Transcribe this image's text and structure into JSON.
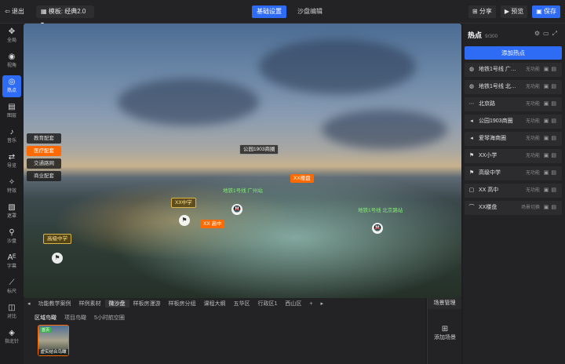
{
  "topbar": {
    "exit_label": "退出",
    "template_label": "模板: 经典2.0",
    "tabs": [
      {
        "label": "基础设置",
        "active": true
      },
      {
        "label": "沙盘编辑",
        "active": false
      }
    ],
    "share_label": "分享",
    "preview_label": "预览",
    "save_label": "保存"
  },
  "leftbar": {
    "items": [
      {
        "label": "全局",
        "icon": "move-icon"
      },
      {
        "label": "视角",
        "icon": "eye-icon"
      },
      {
        "label": "热点",
        "icon": "hotspot-icon",
        "active": true
      },
      {
        "label": "图层",
        "icon": "layers-icon"
      },
      {
        "label": "音乐",
        "icon": "music-icon"
      },
      {
        "label": "导览",
        "icon": "guide-icon"
      },
      {
        "label": "特效",
        "icon": "effects-icon"
      },
      {
        "label": "遮罩",
        "icon": "mask-icon"
      },
      {
        "label": "沙盘",
        "icon": "location-icon"
      },
      {
        "label": "字幕",
        "icon": "text-icon"
      },
      {
        "label": "标尺",
        "icon": "ruler-icon"
      },
      {
        "label": "对比",
        "icon": "compare-icon"
      },
      {
        "label": "指北针",
        "icon": "compass-icon"
      }
    ]
  },
  "viewport": {
    "tags": [
      {
        "label": "教育配套",
        "active": false
      },
      {
        "label": "医疗配套",
        "active": true
      },
      {
        "label": "交通路网",
        "active": false
      },
      {
        "label": "商业配套",
        "active": false
      }
    ],
    "hotspots": {
      "park": "公园1903商圈",
      "xx_plate": "XX楼盘",
      "xx_middle": "XX中学",
      "xx_high": "XX 高中",
      "gaoji": "高级中学",
      "metro1": "地铁1号线 广州站",
      "metro2": "地铁1号线 北京路站",
      "beijing": "北京路"
    }
  },
  "scenebar": {
    "tabs": [
      {
        "label": "功能教学案例",
        "active": false
      },
      {
        "label": "样例素材",
        "active": false
      },
      {
        "label": "微沙盘",
        "active": true
      },
      {
        "label": "样板房漫游",
        "active": false
      },
      {
        "label": "样板房分组",
        "active": false
      },
      {
        "label": "课程大纲",
        "active": false
      },
      {
        "label": "五华区",
        "active": false
      },
      {
        "label": "行政区1",
        "active": false
      },
      {
        "label": "西山区",
        "active": false
      }
    ],
    "subtabs": [
      {
        "label": "区域鸟瞰",
        "active": true
      },
      {
        "label": "项目鸟瞰",
        "active": false
      },
      {
        "label": "5小时航空圈",
        "active": false
      }
    ],
    "thumb_caption": "虚实结合鸟瞰",
    "thumb_badge": "首页"
  },
  "scene_manager": {
    "title": "场景管理",
    "add_label": "添加场景"
  },
  "rightpanel": {
    "title": "热点",
    "count": "9/300",
    "add_label": "添加热点",
    "rows": [
      {
        "name": "地铁1号线 广州站",
        "fn": "无功能",
        "icon": "metro-icon"
      },
      {
        "name": "地铁1号线 北京路站",
        "fn": "无功能",
        "icon": "metro-icon"
      },
      {
        "name": "北京路",
        "fn": "无功能",
        "icon": "dots-icon"
      },
      {
        "name": "公园1903商圈",
        "fn": "无功能",
        "icon": "tag-icon"
      },
      {
        "name": "爱琴海商圈",
        "fn": "无功能",
        "icon": "tag-icon"
      },
      {
        "name": "XX小学",
        "fn": "无功能",
        "icon": "flag-icon"
      },
      {
        "name": "高级中学",
        "fn": "无功能",
        "icon": "flag-icon"
      },
      {
        "name": "XX 高中",
        "fn": "无功能",
        "icon": "frame-icon"
      },
      {
        "name": "XX楼盘",
        "fn": "场景切换",
        "icon": "roof-icon"
      }
    ]
  }
}
